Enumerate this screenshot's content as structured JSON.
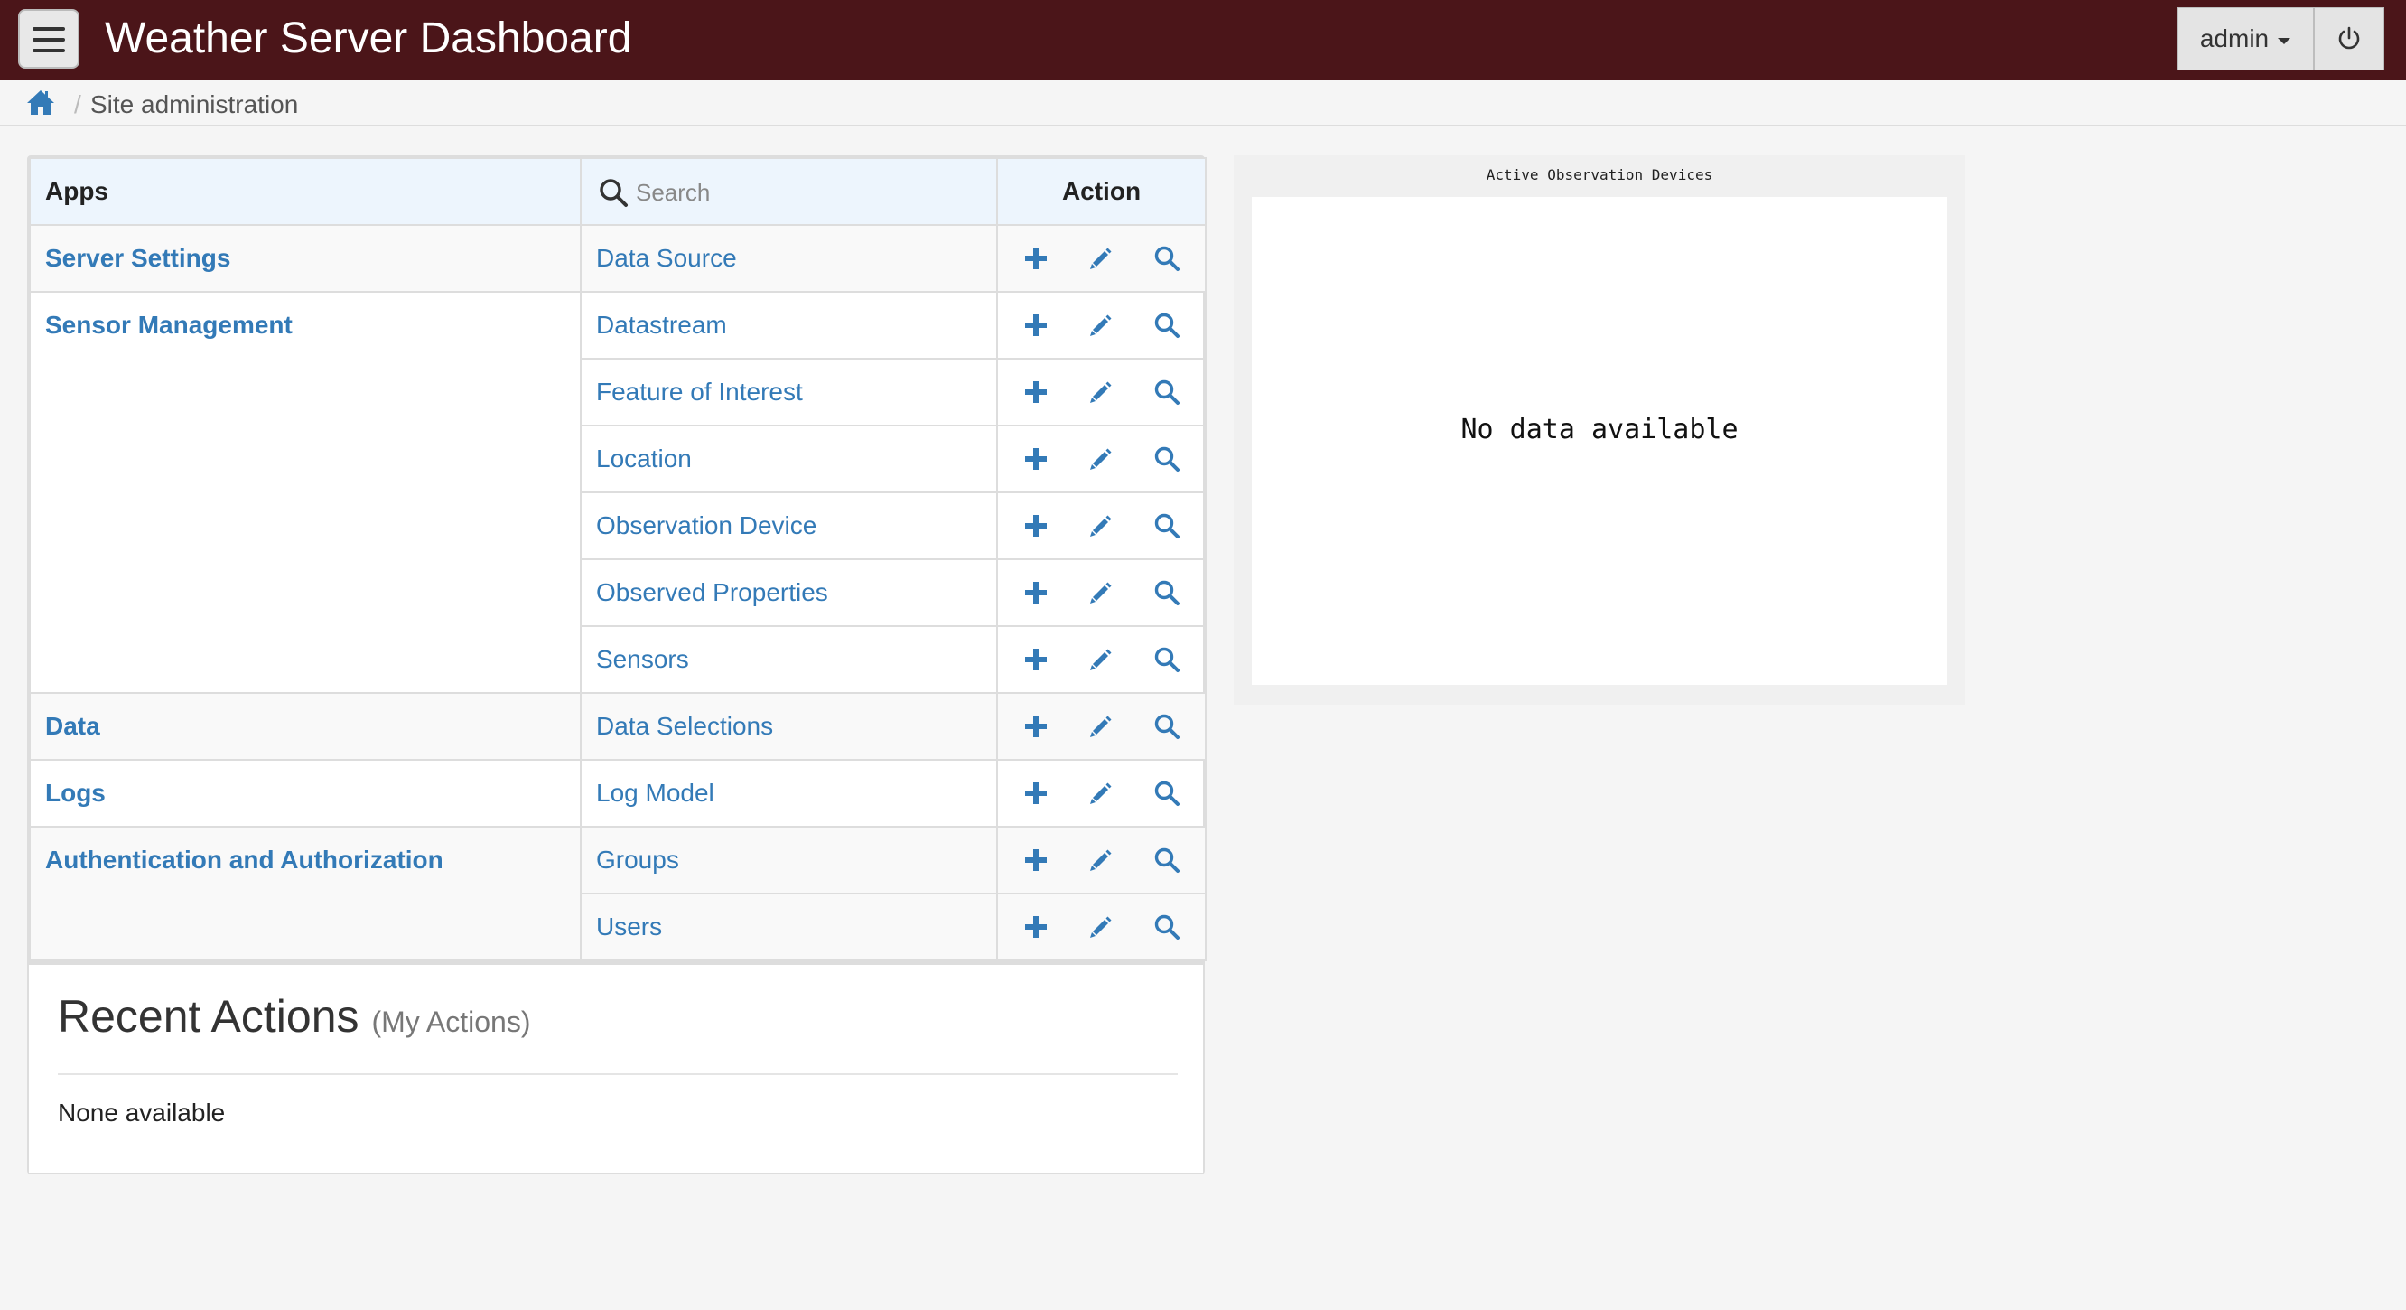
{
  "header": {
    "title": "Weather Server Dashboard",
    "user_label": "admin",
    "menu_icon": "hamburger-icon",
    "logout_icon": "power-icon",
    "background_color": "#4b1519"
  },
  "breadcrumb": {
    "home_icon": "home-icon",
    "separator": "/",
    "current": "Site administration"
  },
  "apps_table": {
    "columns": {
      "apps": "Apps",
      "search_placeholder": "Search",
      "action": "Action"
    },
    "rows": [
      {
        "app": "Server Settings",
        "model": "Data Source"
      },
      {
        "app": "Sensor Management",
        "model": "Datastream"
      },
      {
        "app": "",
        "model": "Feature of Interest"
      },
      {
        "app": "",
        "model": "Location"
      },
      {
        "app": "",
        "model": "Observation Device"
      },
      {
        "app": "",
        "model": "Observed Properties"
      },
      {
        "app": "",
        "model": "Sensors"
      },
      {
        "app": "Data",
        "model": "Data Selections"
      },
      {
        "app": "Logs",
        "model": "Log Model"
      },
      {
        "app": "Authentication and Authorization",
        "model": "Groups"
      },
      {
        "app": "",
        "model": "Users"
      }
    ],
    "action_icons": [
      "plus-icon",
      "pencil-icon",
      "search-icon"
    ],
    "link_color": "#337ab7"
  },
  "recent_actions": {
    "title": "Recent Actions",
    "subtitle": "(My Actions)",
    "empty_text": "None available"
  },
  "chart": {
    "title": "Active Observation Devices",
    "empty_text": "No data available"
  }
}
